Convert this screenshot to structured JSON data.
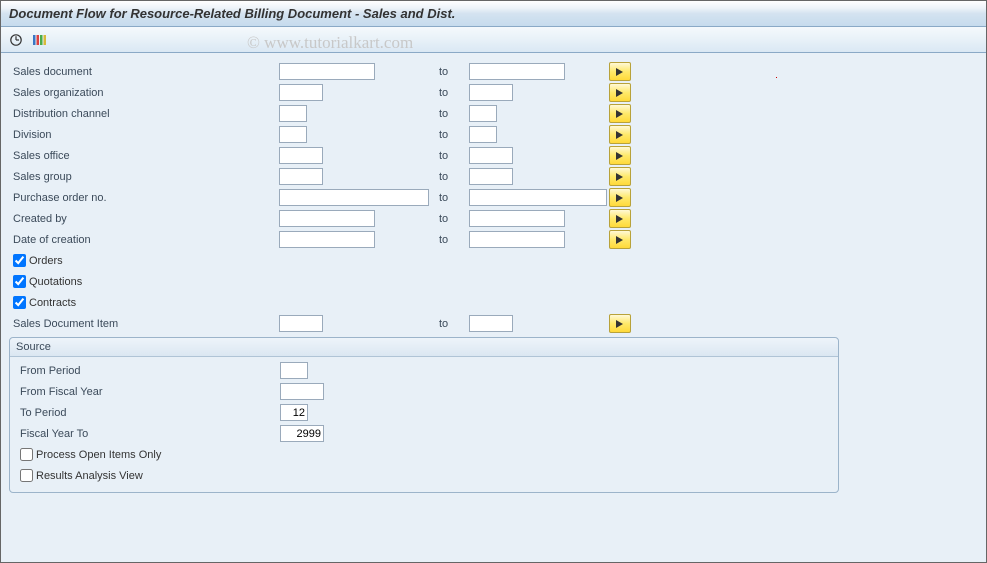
{
  "watermark": "© www.tutorialkart.com",
  "title": "Document Flow for Resource-Related Billing Document - Sales and Dist.",
  "to_label": "to",
  "fields": {
    "sales_document": {
      "label": "Sales document",
      "from": "",
      "to": ""
    },
    "sales_org": {
      "label": "Sales organization",
      "from": "",
      "to": ""
    },
    "dist_channel": {
      "label": "Distribution channel",
      "from": "",
      "to": ""
    },
    "division": {
      "label": "Division",
      "from": "",
      "to": ""
    },
    "sales_office": {
      "label": "Sales office",
      "from": "",
      "to": ""
    },
    "sales_group": {
      "label": "Sales group",
      "from": "",
      "to": ""
    },
    "po_no": {
      "label": "Purchase order no.",
      "from": "",
      "to": ""
    },
    "created_by": {
      "label": "Created by",
      "from": "",
      "to": ""
    },
    "date_creation": {
      "label": "Date of creation",
      "from": "",
      "to": ""
    },
    "sales_doc_item": {
      "label": "Sales Document Item",
      "from": "",
      "to": ""
    }
  },
  "checkboxes": {
    "orders": {
      "label": "Orders",
      "checked": true
    },
    "quotations": {
      "label": "Quotations",
      "checked": true
    },
    "contracts": {
      "label": "Contracts",
      "checked": true
    }
  },
  "source": {
    "title": "Source",
    "from_period": {
      "label": "From Period",
      "value": ""
    },
    "from_fy": {
      "label": "From Fiscal Year",
      "value": ""
    },
    "to_period": {
      "label": "To Period",
      "value": "12"
    },
    "fy_to": {
      "label": "Fiscal Year To",
      "value": "2999"
    },
    "open_items": {
      "label": "Process Open Items Only",
      "checked": false
    },
    "ra_view": {
      "label": "Results Analysis View",
      "checked": false
    }
  }
}
